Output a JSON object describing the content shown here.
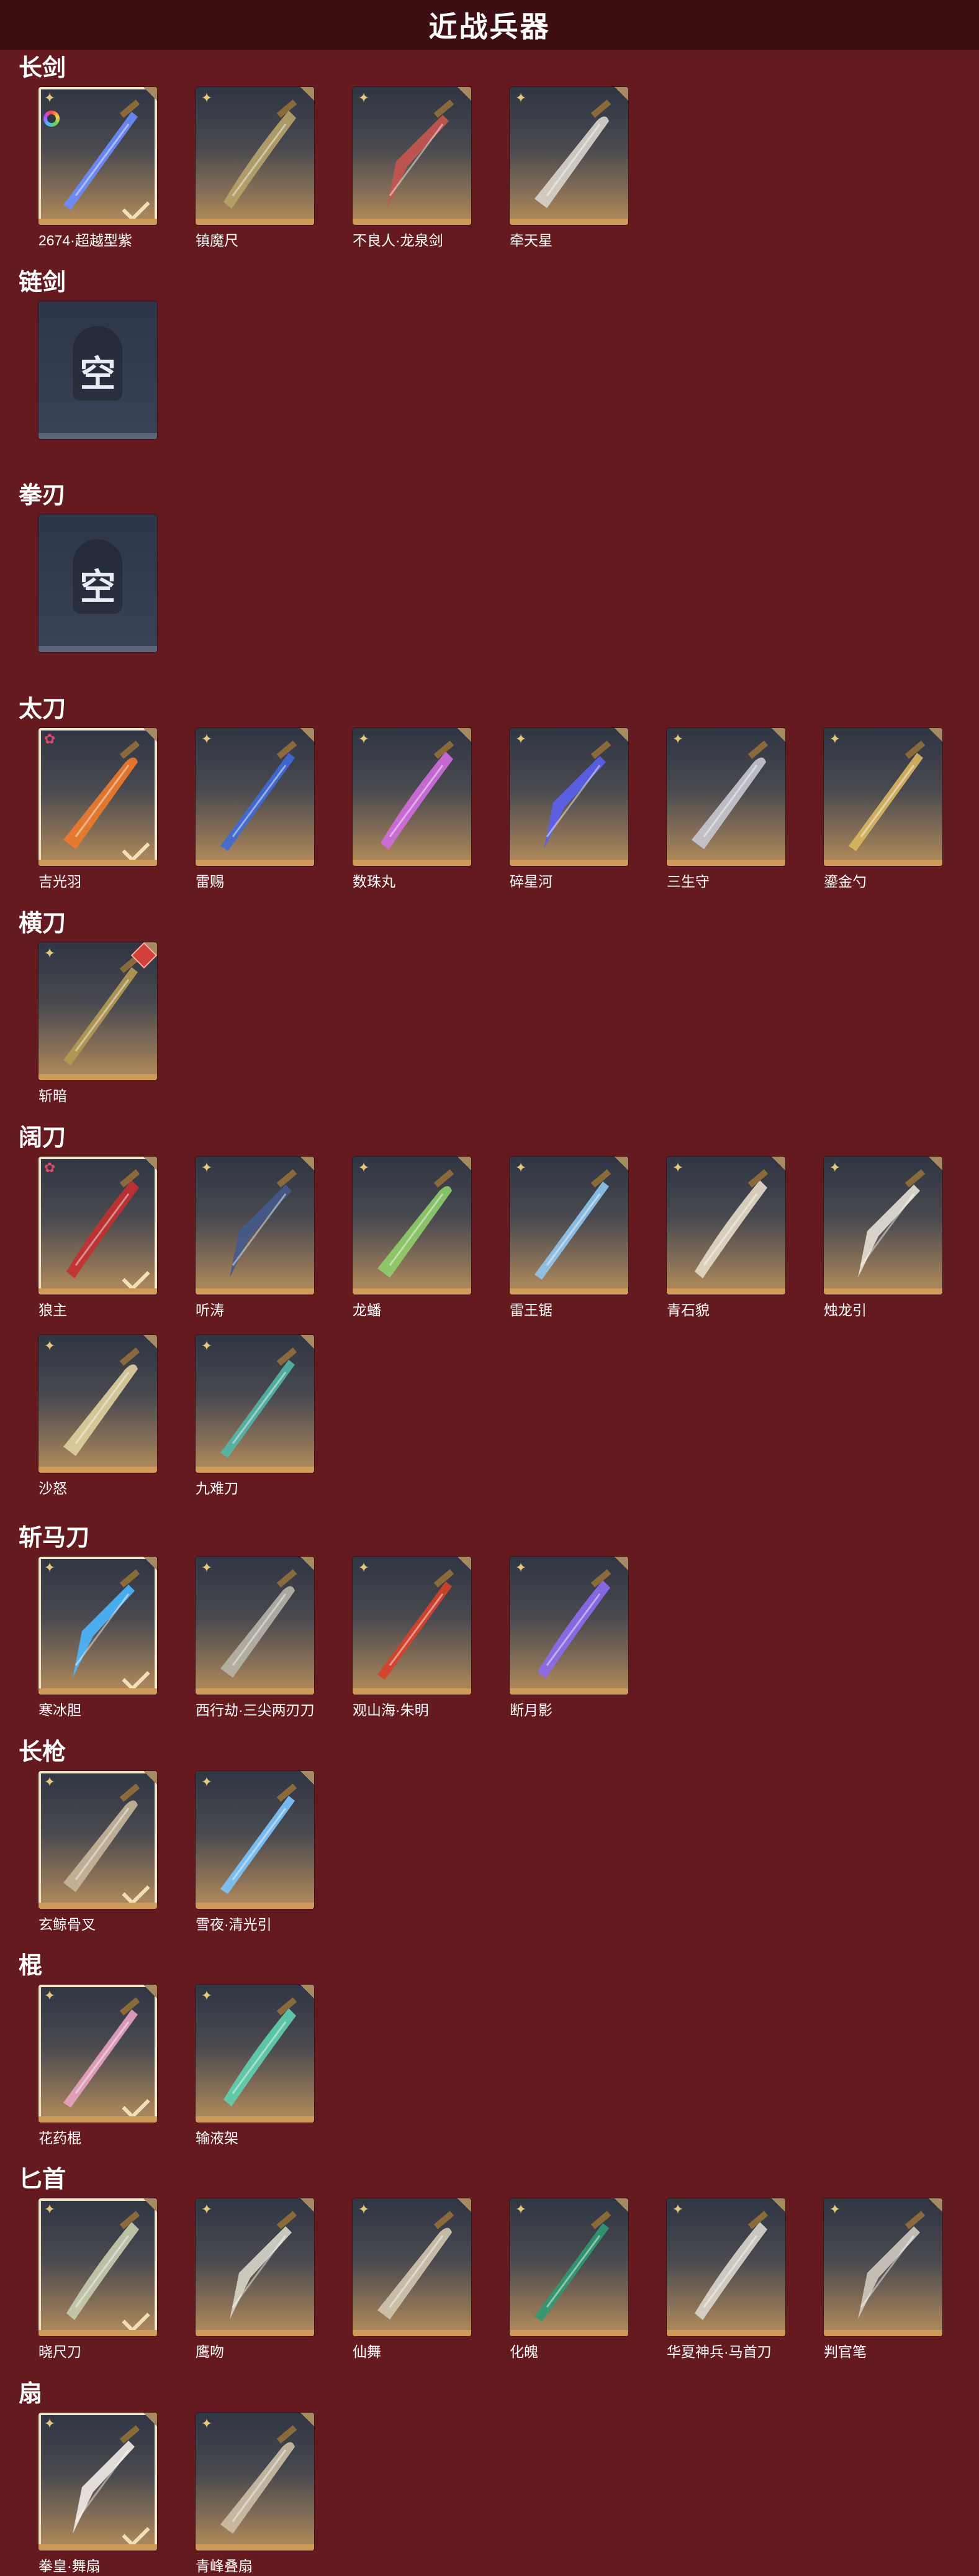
{
  "header": {
    "title": "近战兵器"
  },
  "sections": [
    {
      "title": "长剑",
      "items": [
        {
          "name": "2674·超越型紫",
          "selected": true,
          "rarity": "gold",
          "extra": "rainbow",
          "weapon_color": "#6b8cff"
        },
        {
          "name": "镇魔尺",
          "rarity": "gold",
          "weapon_color": "#b8a36a"
        },
        {
          "name": "不良人·龙泉剑",
          "rarity": "gold",
          "weapon_color": "#c7554f"
        },
        {
          "name": "牵天星",
          "rarity": "gold",
          "weapon_color": "#d8d4cc"
        }
      ]
    },
    {
      "title": "链剑",
      "items": [
        {
          "empty": true,
          "empty_label": "空"
        }
      ]
    },
    {
      "title": "拳刃",
      "items": [
        {
          "empty": true,
          "empty_label": "空"
        }
      ]
    },
    {
      "title": "太刀",
      "items": [
        {
          "name": "吉光羽",
          "selected": true,
          "rarity": "red",
          "weapon_color": "#f07a2b"
        },
        {
          "name": "雷赐",
          "rarity": "gold",
          "weapon_color": "#3f6ad8"
        },
        {
          "name": "数珠丸",
          "rarity": "gold",
          "weapon_color": "#d26be0"
        },
        {
          "name": "碎星河",
          "rarity": "gold",
          "weapon_color": "#5b5ff0"
        },
        {
          "name": "三生守",
          "rarity": "gold",
          "weapon_color": "#c8c8d2"
        },
        {
          "name": "鎏金勺",
          "rarity": "gold",
          "weapon_color": "#d9b760"
        }
      ]
    },
    {
      "title": "横刀",
      "items": [
        {
          "name": "斩暗",
          "rarity": "gold",
          "extra": "diamond",
          "weapon_color": "#b59a52"
        }
      ]
    },
    {
      "title": "阔刀",
      "items": [
        {
          "name": "狼主",
          "selected": true,
          "rarity": "red",
          "weapon_color": "#c43030"
        },
        {
          "name": "听涛",
          "rarity": "gold",
          "weapon_color": "#445a8c"
        },
        {
          "name": "龙蟠",
          "rarity": "gold",
          "weapon_color": "#8fcf6a"
        },
        {
          "name": "雷王锯",
          "rarity": "gold",
          "weapon_color": "#8fc7f0"
        },
        {
          "name": "青石貌",
          "rarity": "gold",
          "weapon_color": "#e6dbc8"
        },
        {
          "name": "烛龙引",
          "rarity": "gold",
          "weapon_color": "#e6e0d6"
        },
        {
          "name": "沙怒",
          "rarity": "gold",
          "weapon_color": "#e0d2a0"
        },
        {
          "name": "九难刀",
          "rarity": "gold",
          "weapon_color": "#52b7a8"
        }
      ]
    },
    {
      "title": "斩马刀",
      "items": [
        {
          "name": "寒冰胆",
          "selected": true,
          "rarity": "gold",
          "weapon_color": "#4ab7ff"
        },
        {
          "name": "西行劫·三尖两刃刀",
          "rarity": "gold",
          "weapon_color": "#b7b4a8"
        },
        {
          "name": "观山海·朱明",
          "rarity": "gold",
          "weapon_color": "#d8402a"
        },
        {
          "name": "断月影",
          "rarity": "gold",
          "weapon_color": "#8c6cf0"
        }
      ]
    },
    {
      "title": "长枪",
      "items": [
        {
          "name": "玄鲸骨叉",
          "selected": true,
          "rarity": "gold",
          "weapon_color": "#c9b79b"
        },
        {
          "name": "雪夜·清光引",
          "rarity": "gold",
          "weapon_color": "#7cc7ff"
        }
      ]
    },
    {
      "title": "棍",
      "items": [
        {
          "name": "花药棍",
          "selected": true,
          "rarity": "gold",
          "weapon_color": "#e9a2c2"
        },
        {
          "name": "输液架",
          "rarity": "gold",
          "weapon_color": "#5fd1b0"
        }
      ]
    },
    {
      "title": "匕首",
      "items": [
        {
          "name": "晓尺刀",
          "selected": true,
          "rarity": "gold",
          "weapon_color": "#c9cdb0"
        },
        {
          "name": "鹰吻",
          "rarity": "gold",
          "weapon_color": "#d8d6c8"
        },
        {
          "name": "仙舞",
          "rarity": "gold",
          "weapon_color": "#d3c7b0"
        },
        {
          "name": "化魄",
          "rarity": "gold",
          "weapon_color": "#2f9a73"
        },
        {
          "name": "华夏神兵·马首刀",
          "rarity": "gold",
          "weapon_color": "#dad6cc"
        },
        {
          "name": "判官笔",
          "rarity": "gold",
          "weapon_color": "#cfc9bf"
        }
      ]
    },
    {
      "title": "扇",
      "items": [
        {
          "name": "拳皇·舞扇",
          "selected": true,
          "rarity": "gold",
          "weapon_color": "#f2ece5"
        },
        {
          "name": "青峰叠扇",
          "rarity": "gold",
          "weapon_color": "#cdbfa6"
        }
      ]
    }
  ]
}
